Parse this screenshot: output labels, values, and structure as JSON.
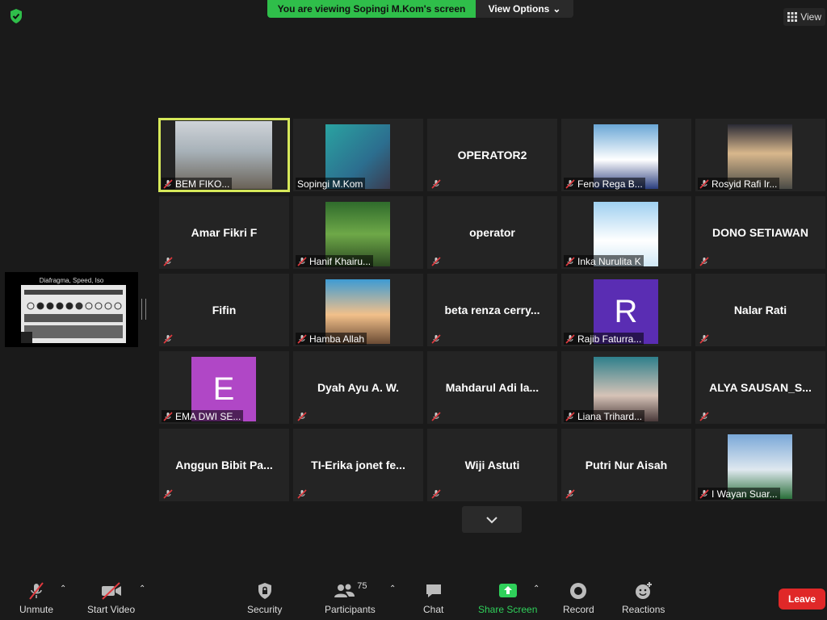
{
  "banner": {
    "viewing": "You are viewing Sopingi M.Kom's screen",
    "options": "View Options"
  },
  "view": "View",
  "share": {
    "title": "Diafragma, Speed, Iso"
  },
  "participants": [
    {
      "name": "BEM FIKO...",
      "type": "video",
      "active": true
    },
    {
      "name": "Sopingi M.Kom",
      "type": "video"
    },
    {
      "name": "OPERATOR2",
      "type": "name"
    },
    {
      "name": "Feno Rega B...",
      "type": "video"
    },
    {
      "name": "Rosyid Rafi Ir...",
      "type": "video"
    },
    {
      "name": "Amar Fikri F",
      "type": "name"
    },
    {
      "name": "Hanif Khairu...",
      "type": "video"
    },
    {
      "name": "operator",
      "type": "name"
    },
    {
      "name": "Inka Nurulita K",
      "type": "video"
    },
    {
      "name": "DONO SETIAWAN",
      "type": "name"
    },
    {
      "name": "Fifin",
      "type": "name"
    },
    {
      "name": "Hamba Allah",
      "type": "video"
    },
    {
      "name": "beta renza cerry...",
      "type": "name"
    },
    {
      "name": "Rajib Faturra...",
      "type": "avatar",
      "initial": "R",
      "color": "#5a2db3"
    },
    {
      "name": "Nalar Rati",
      "type": "name"
    },
    {
      "name": "EMA DWI SE...",
      "type": "avatar",
      "initial": "E",
      "color": "#b047c6"
    },
    {
      "name": "Dyah Ayu A. W.",
      "type": "name"
    },
    {
      "name": "Mahdarul Adi la...",
      "type": "name"
    },
    {
      "name": "Liana Trihard...",
      "type": "video"
    },
    {
      "name": "ALYA SAUSAN_S...",
      "type": "name"
    },
    {
      "name": "Anggun Bibit Pa...",
      "type": "name"
    },
    {
      "name": "TI-Erika jonet fe...",
      "type": "name"
    },
    {
      "name": "Wiji Astuti",
      "type": "name"
    },
    {
      "name": "Putri Nur Aisah",
      "type": "name"
    },
    {
      "name": "I Wayan Suar...",
      "type": "video"
    }
  ],
  "toolbar": {
    "unmute": "Unmute",
    "start_video": "Start Video",
    "security": "Security",
    "participants": "Participants",
    "participants_count": "75",
    "chat": "Chat",
    "share_screen": "Share Screen",
    "record": "Record",
    "reactions": "Reactions",
    "leave": "Leave"
  },
  "colors": {
    "banner_green": "#2fbe4a",
    "active_border": "#d6e85a",
    "leave_red": "#e02828",
    "share_green": "#2fd05a"
  }
}
